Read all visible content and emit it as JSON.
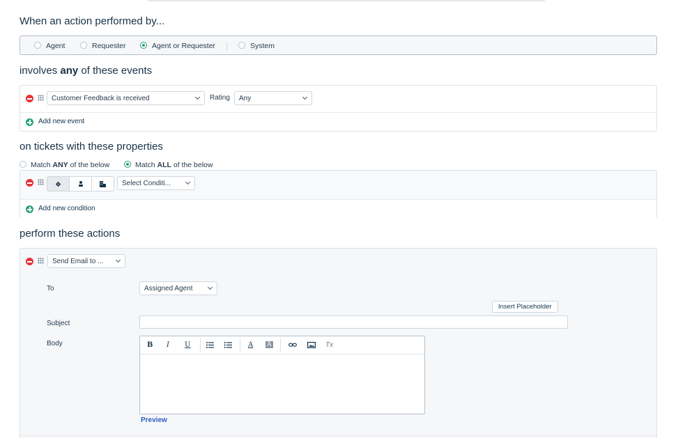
{
  "performed_by": {
    "heading": "When an action performed by...",
    "options": [
      {
        "label": "Agent",
        "selected": false
      },
      {
        "label": "Requester",
        "selected": false
      },
      {
        "label": "Agent or Requester",
        "selected": true
      },
      {
        "label": "System",
        "selected": false
      }
    ]
  },
  "events": {
    "heading_prefix": "involves ",
    "heading_bold": "any",
    "heading_suffix": " of these events",
    "event_select": "Customer Feedback is received",
    "rating_label": "Rating",
    "rating_select": "Any",
    "add_label": "Add new event"
  },
  "properties": {
    "heading": "on tickets with these properties",
    "match_any_prefix": "Match ",
    "match_any_bold": "ANY",
    "match_any_suffix": " of the below",
    "match_all_prefix": "Match ",
    "match_all_bold": "ALL",
    "match_all_suffix": " of the below",
    "match_selected": "all",
    "condition_select": "Select Conditi...",
    "add_label": "Add new condition"
  },
  "actions": {
    "heading": "perform these actions",
    "action_select": "Send Email to ...",
    "to_label": "To",
    "to_select": "Assigned Agent",
    "insert_placeholder": "Insert Placeholder",
    "subject_label": "Subject",
    "subject_value": "",
    "body_label": "Body",
    "toolbar": {
      "bold": "B",
      "italic": "I",
      "underline": "U",
      "font_color": "A",
      "bg_color": "A"
    },
    "preview_label": "Preview"
  },
  "colors": {
    "accent_green": "#27a27a",
    "remove_red": "#e43538",
    "link_blue": "#2c5cc5"
  }
}
